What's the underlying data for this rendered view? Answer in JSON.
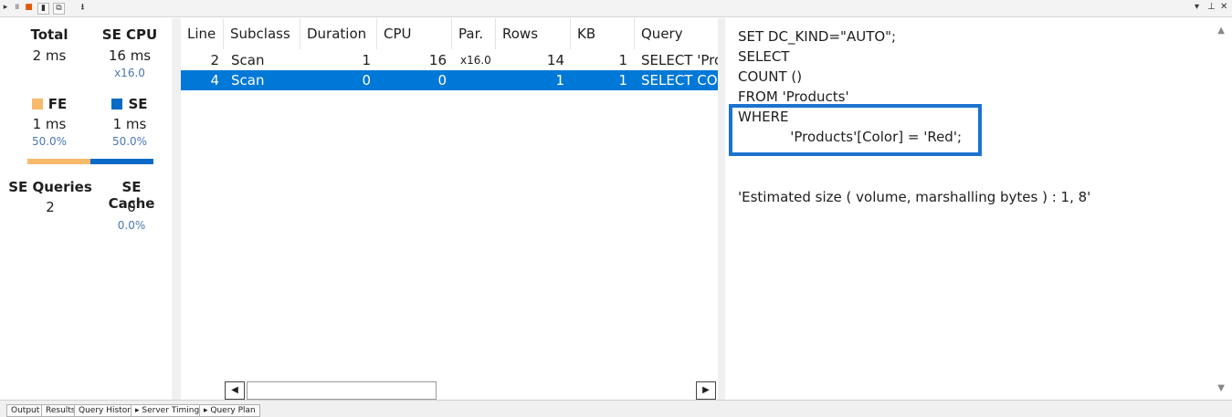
{
  "toolbar": {
    "right_icons": [
      "▾",
      "⊥",
      "✕"
    ]
  },
  "summary": {
    "total_label": "Total",
    "total_value": "2 ms",
    "secpu_label": "SE CPU",
    "secpu_value": "16 ms",
    "secpu_ratio": "x16.0",
    "fe_label": "FE",
    "fe_value": "1 ms",
    "fe_pct": "50.0%",
    "se_label": "SE",
    "se_value": "1 ms",
    "se_pct": "50.0%",
    "fe_fraction": 0.5,
    "se_queries_label": "SE Queries",
    "se_queries_value": "2",
    "se_cache_label": "SE Cache",
    "se_cache_value": "0",
    "se_cache_pct": "0.0%",
    "colors": {
      "fe": "#f7b96a",
      "se": "#0a6ac7"
    }
  },
  "grid": {
    "columns": [
      "Line",
      "Subclass",
      "Duration",
      "CPU",
      "Par.",
      "Rows",
      "KB",
      "Query"
    ],
    "rows": [
      {
        "line": "2",
        "subclass": "Scan",
        "duration": "1",
        "cpu": "16",
        "par": "x16.0",
        "rows": "14",
        "kb": "1",
        "query": "SELECT 'Pro"
      },
      {
        "line": "4",
        "subclass": "Scan",
        "duration": "0",
        "cpu": "0",
        "par": "",
        "rows": "1",
        "kb": "1",
        "query": "SELECT COU"
      }
    ],
    "selected_row": 1
  },
  "query": {
    "lines": [
      "SET DC_KIND=\"AUTO\";",
      "SELECT",
      "COUNT ()",
      "FROM 'Products'",
      "WHERE",
      "            'Products'[Color] = 'Red';",
      "",
      "",
      "'Estimated size ( volume, marshalling bytes ) : 1, 8'"
    ]
  },
  "tabs": [
    {
      "label": "Output"
    },
    {
      "label": "Results"
    },
    {
      "label": "Query History"
    },
    {
      "label": "Server Timings"
    },
    {
      "label": "Query Plan"
    }
  ]
}
